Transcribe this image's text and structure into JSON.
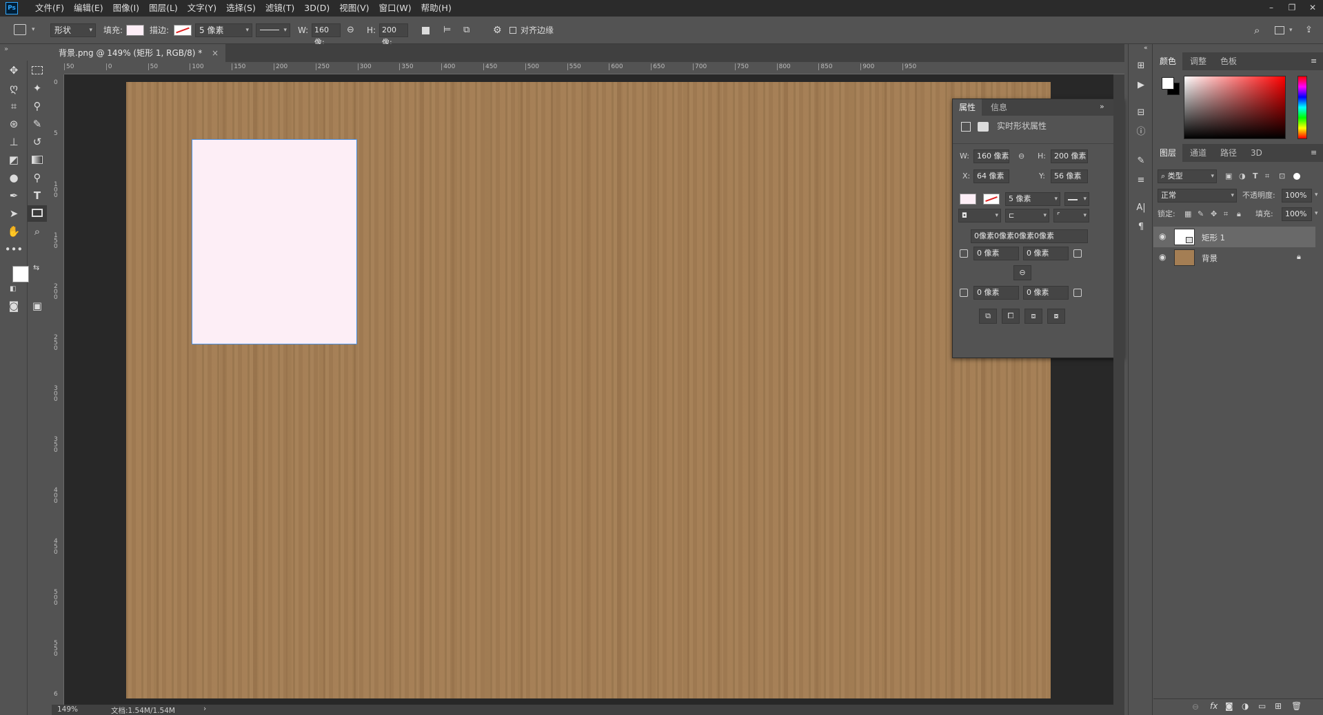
{
  "app": {
    "logo": "Ps"
  },
  "menu": [
    "文件(F)",
    "编辑(E)",
    "图像(I)",
    "图层(L)",
    "文字(Y)",
    "选择(S)",
    "滤镜(T)",
    "3D(D)",
    "视图(V)",
    "窗口(W)",
    "帮助(H)"
  ],
  "window_controls": {
    "minimize": "–",
    "restore": "❐",
    "close": "✕"
  },
  "options": {
    "mode": "形状",
    "fill_label": "填充:",
    "stroke_label": "描边:",
    "stroke_width": "5 像素",
    "w_label": "W:",
    "w_value": "160 像:",
    "h_label": "H:",
    "h_value": "200 像:",
    "align_edges": "对齐边缘",
    "fill_color": "#fdeef6"
  },
  "document": {
    "tab_title": "背景.png @ 149% (矩形 1, RGB/8) *",
    "close": "×",
    "ruler_top": [
      "50",
      "0",
      "50",
      "100",
      "150",
      "200",
      "250",
      "300",
      "350",
      "400",
      "450",
      "500",
      "550",
      "600",
      "650",
      "700",
      "750",
      "800",
      "850",
      "900",
      "950"
    ],
    "ruler_left": [
      "0",
      "5",
      "1 0 0",
      "1 5 0",
      "2 0 0",
      "2 5 0",
      "3 0 0",
      "3 5 0",
      "4 0 0",
      "4 5 0",
      "5 0 0",
      "5 5 0",
      "6"
    ],
    "zoom": "149%",
    "doc_size": "文档:1.54M/1.54M",
    "status_arrow": "›"
  },
  "properties": {
    "tabs": [
      "属性",
      "信息"
    ],
    "title": "实时形状属性",
    "w_label": "W:",
    "w": "160 像素",
    "h_label": "H:",
    "h": "200 像素",
    "x_label": "X:",
    "x": "64 像素",
    "y_label": "Y:",
    "y": "56 像素",
    "stroke_width": "5 像素",
    "radius_all": "0像素0像素0像素0像素",
    "r1": "0 像素",
    "r2": "0 像素",
    "r3": "0 像素",
    "r4": "0 像素",
    "expand": "»"
  },
  "color_panel": {
    "tabs": [
      "颜色",
      "调整",
      "色板"
    ],
    "foreground": "#ffffff",
    "background": "#000000"
  },
  "layers_panel": {
    "tabs": [
      "图层",
      "通道",
      "路径",
      "3D"
    ],
    "filter": "类型",
    "blend": "正常",
    "opacity_label": "不透明度:",
    "opacity": "100%",
    "lock_label": "锁定:",
    "fill_label": "填充:",
    "fill": "100%",
    "layers": [
      {
        "name": "矩形 1",
        "selected": true
      },
      {
        "name": "背景",
        "selected": false
      }
    ],
    "bottom_icons": [
      "link-icon",
      "fx-icon",
      "mask-icon",
      "adjustment-icon",
      "folder-icon",
      "new-layer-icon",
      "trash-icon"
    ]
  },
  "colors": {
    "accent": "#31a8ff",
    "canvas": "#a47e54",
    "shape_fill": "#fdeef6",
    "shape_stroke": "#4a90e2"
  }
}
